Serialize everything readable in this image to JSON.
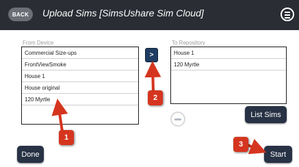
{
  "header": {
    "back_label": "BACK",
    "title": "Upload Sims [SimsUshare Sim Cloud]"
  },
  "from_device": {
    "label": "From Device",
    "items": [
      "Commercial Size-ups",
      "FrontViewSmoke",
      "House 1",
      "House original",
      "120 Myrtle"
    ]
  },
  "to_repository": {
    "label": "To Repository",
    "items": [
      "House 1",
      "120 Myrtle"
    ]
  },
  "buttons": {
    "move_label": ">",
    "list_sims_label": "List Sims",
    "done_label": "Done",
    "start_label": "Start"
  },
  "annotations": {
    "callouts": [
      "1",
      "2",
      "3"
    ],
    "color": "#d5351f"
  },
  "icons": {
    "menu": "hamburger-circle-icon",
    "remove": "minus-circle-icon"
  },
  "colors": {
    "header_bg": "#2a2d34",
    "button_bg": "#273245",
    "move_button_bg": "#1f3d63",
    "callout": "#d5351f"
  }
}
